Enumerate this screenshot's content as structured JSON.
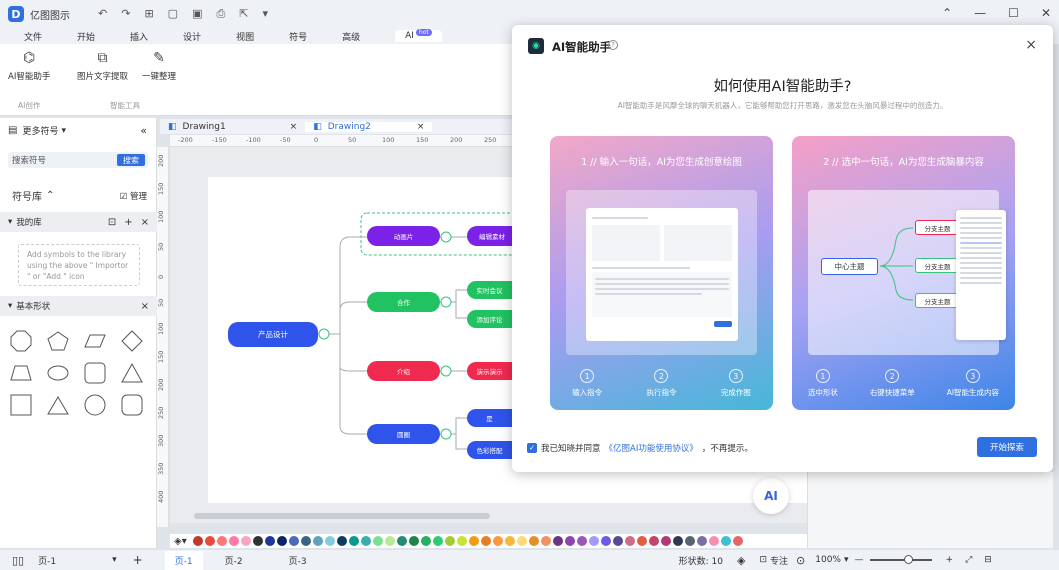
{
  "app": {
    "title": "亿图图示",
    "logo": "D"
  },
  "menu": [
    "文件",
    "开始",
    "插入",
    "设计",
    "视图",
    "符号",
    "高级",
    "AI"
  ],
  "menu_badge": "hot",
  "ribbon": {
    "items": [
      {
        "label": "AI智能助手",
        "icon": "ai-robot-icon"
      },
      {
        "label": "图片文字提取",
        "icon": "ocr-icon"
      },
      {
        "label": "一键整理",
        "icon": "tidy-icon"
      }
    ],
    "groups": [
      "AI创作",
      "智能工具"
    ]
  },
  "left_panel": {
    "title": "更多符号",
    "search_placeholder": "搜索符号",
    "search_button": "搜索",
    "library_label": "符号库",
    "manage_label": "管理",
    "my_library": "我的库",
    "empty_hint": "Add symbols to the library using the above \" Importor \" or  \"Add \" icon",
    "basic_shapes": "基本形状"
  },
  "tabs": [
    {
      "label": "Drawing1",
      "active": false
    },
    {
      "label": "Drawing2",
      "active": true
    }
  ],
  "ruler_h": [
    "-200",
    "-150",
    "-100",
    "-50",
    "0",
    "50",
    "100",
    "150",
    "200",
    "250"
  ],
  "ruler_v": [
    "200",
    "150",
    "100",
    "50",
    "0",
    "50",
    "100",
    "150",
    "200",
    "250",
    "300",
    "350",
    "400"
  ],
  "mindmap": {
    "root": "产品设计",
    "branches": [
      "动画片",
      "合作",
      "介绍",
      "圆圈"
    ],
    "leaves": [
      "编辑素材",
      "实时会议",
      "添加评论",
      "演示演示",
      "是",
      "色彩搭配"
    ]
  },
  "status": {
    "page_selector": "页-1",
    "pages": [
      "页-1",
      "页-2",
      "页-3"
    ],
    "shape_count": "形状数: 10",
    "focus": "专注",
    "zoom": "100%"
  },
  "ai_float": "AI",
  "dialog": {
    "title": "AI智能助手",
    "heading": "如何使用AI智能助手?",
    "subtitle": "AI智能助手是风靡全球的聊天机器人，它能够帮助您打开思路，激发您在头脑风暴过程中的创造力。",
    "card1": {
      "title": "1 // 输入一句话，AI为您生成创意绘图",
      "steps": [
        "输入指令",
        "执行指令",
        "完成作图"
      ]
    },
    "card2": {
      "title": "2 // 选中一句话，AI为您生成脑暴内容",
      "steps": [
        "选中形状",
        "右键快捷菜单",
        "AI智能生成内容"
      ],
      "center": "中心主题",
      "branch": "分支主题"
    },
    "agree_prefix": "我已知晓并同意",
    "agree_link": "《亿图AI功能使用协议》",
    "agree_suffix": "，不再提示。",
    "start_button": "开始探索"
  },
  "colors": {
    "accent": "#2f6fe0",
    "palette": [
      "#c0392b",
      "#e74c3c",
      "#ff7675",
      "#fd79a8",
      "#f8a5c2",
      "#2d3436",
      "#1e3799",
      "#0c2461",
      "#4a69bd",
      "#3c6382",
      "#60a3bc",
      "#82ccdd",
      "#0a3d62",
      "#079992",
      "#38ada9",
      "#78e08f",
      "#b8e994",
      "#218c74",
      "#1e8449",
      "#27ae60",
      "#2ecc71",
      "#a3cb38",
      "#c4e538",
      "#f39c12",
      "#e67e22",
      "#fa983a",
      "#f6b93b",
      "#ffda79",
      "#e58e26",
      "#f19066",
      "#6c3483",
      "#8e44ad",
      "#9b59b6",
      "#a29bfe",
      "#6c5ce7",
      "#574b90",
      "#cf6a87",
      "#e15f41",
      "#c44569",
      "#b33771",
      "#303952",
      "#596275",
      "#786fa6",
      "#f78fb3",
      "#3dc1d3",
      "#e66767"
    ]
  }
}
